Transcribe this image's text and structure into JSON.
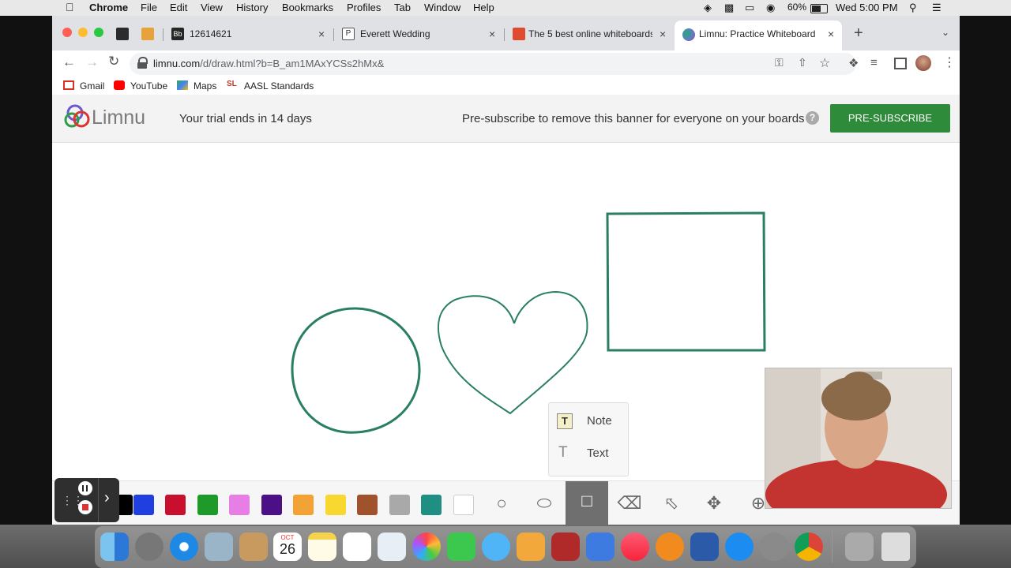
{
  "menubar": {
    "app": "Chrome",
    "items": [
      "File",
      "Edit",
      "View",
      "History",
      "Bookmarks",
      "Profiles",
      "Tab",
      "Window",
      "Help"
    ],
    "battery": "60%",
    "clock": "Wed 5:00 PM"
  },
  "tabs": [
    {
      "title": "",
      "favicon_color": "#2b2b2b"
    },
    {
      "title": "",
      "favicon_color": "#e8a23a"
    },
    {
      "title": "12614621",
      "favicon_color": "#262626"
    },
    {
      "title": "Everett Wedding",
      "favicon_color": "#555555"
    },
    {
      "title": "The 5 best online whiteboards",
      "favicon_color": "#e04a2f"
    },
    {
      "title": "Limnu: Practice Whiteboard",
      "favicon_color": "#6a5acd",
      "active": true
    }
  ],
  "address": {
    "host": "limnu.com",
    "path": "/d/draw.html?b=B_am1MAxYCSs2hMx&"
  },
  "bookmarks": [
    {
      "label": "Gmail",
      "color": "#d93025"
    },
    {
      "label": "YouTube",
      "color": "#ff0000"
    },
    {
      "label": "Maps",
      "color": "#34a853"
    },
    {
      "label": "AASL Standards",
      "color": "#c0392b"
    }
  ],
  "banner": {
    "logo_text": "Limnu",
    "trial": "Your trial ends in 14 days",
    "message": "Pre-subscribe to remove this banner for everyone on your boards",
    "help": "?",
    "button": "PRE-SUBSCRIBE",
    "button_color": "#2e8b3a"
  },
  "drawing": {
    "stroke_color": "#2a7f62",
    "shapes": [
      "circle",
      "heart",
      "rectangle"
    ]
  },
  "text_popup": {
    "items": [
      {
        "icon": "T",
        "label": "Note"
      },
      {
        "icon": "T",
        "label": "Text"
      }
    ]
  },
  "palette": [
    "#000000",
    "#1f3fe0",
    "#c8102e",
    "#1e9a2a",
    "#e67ee6",
    "#4b0f86",
    "#f5a235",
    "#f7d730",
    "#a0522d",
    "#a9a9a9",
    "#1f8f84",
    "#ffffff"
  ],
  "tools": [
    "circle-tool",
    "ellipse-tool",
    "text-tool",
    "eraser-tool",
    "select-tool",
    "move-tool",
    "zoom-tool"
  ],
  "recorder": {
    "pause": "pause",
    "stop": "stop",
    "expand": "›"
  },
  "dock": {
    "calendar_month": "OCT",
    "calendar_day": "26",
    "apps": [
      "finder",
      "launchpad",
      "safari",
      "preview",
      "contacts",
      "calendar",
      "notes",
      "reminders",
      "textedit",
      "photos",
      "facetime",
      "messages",
      "pages",
      "photo-booth",
      "keynote",
      "music",
      "books",
      "word",
      "app-store",
      "system-preferences",
      "chrome",
      "downloads",
      "trash"
    ]
  }
}
